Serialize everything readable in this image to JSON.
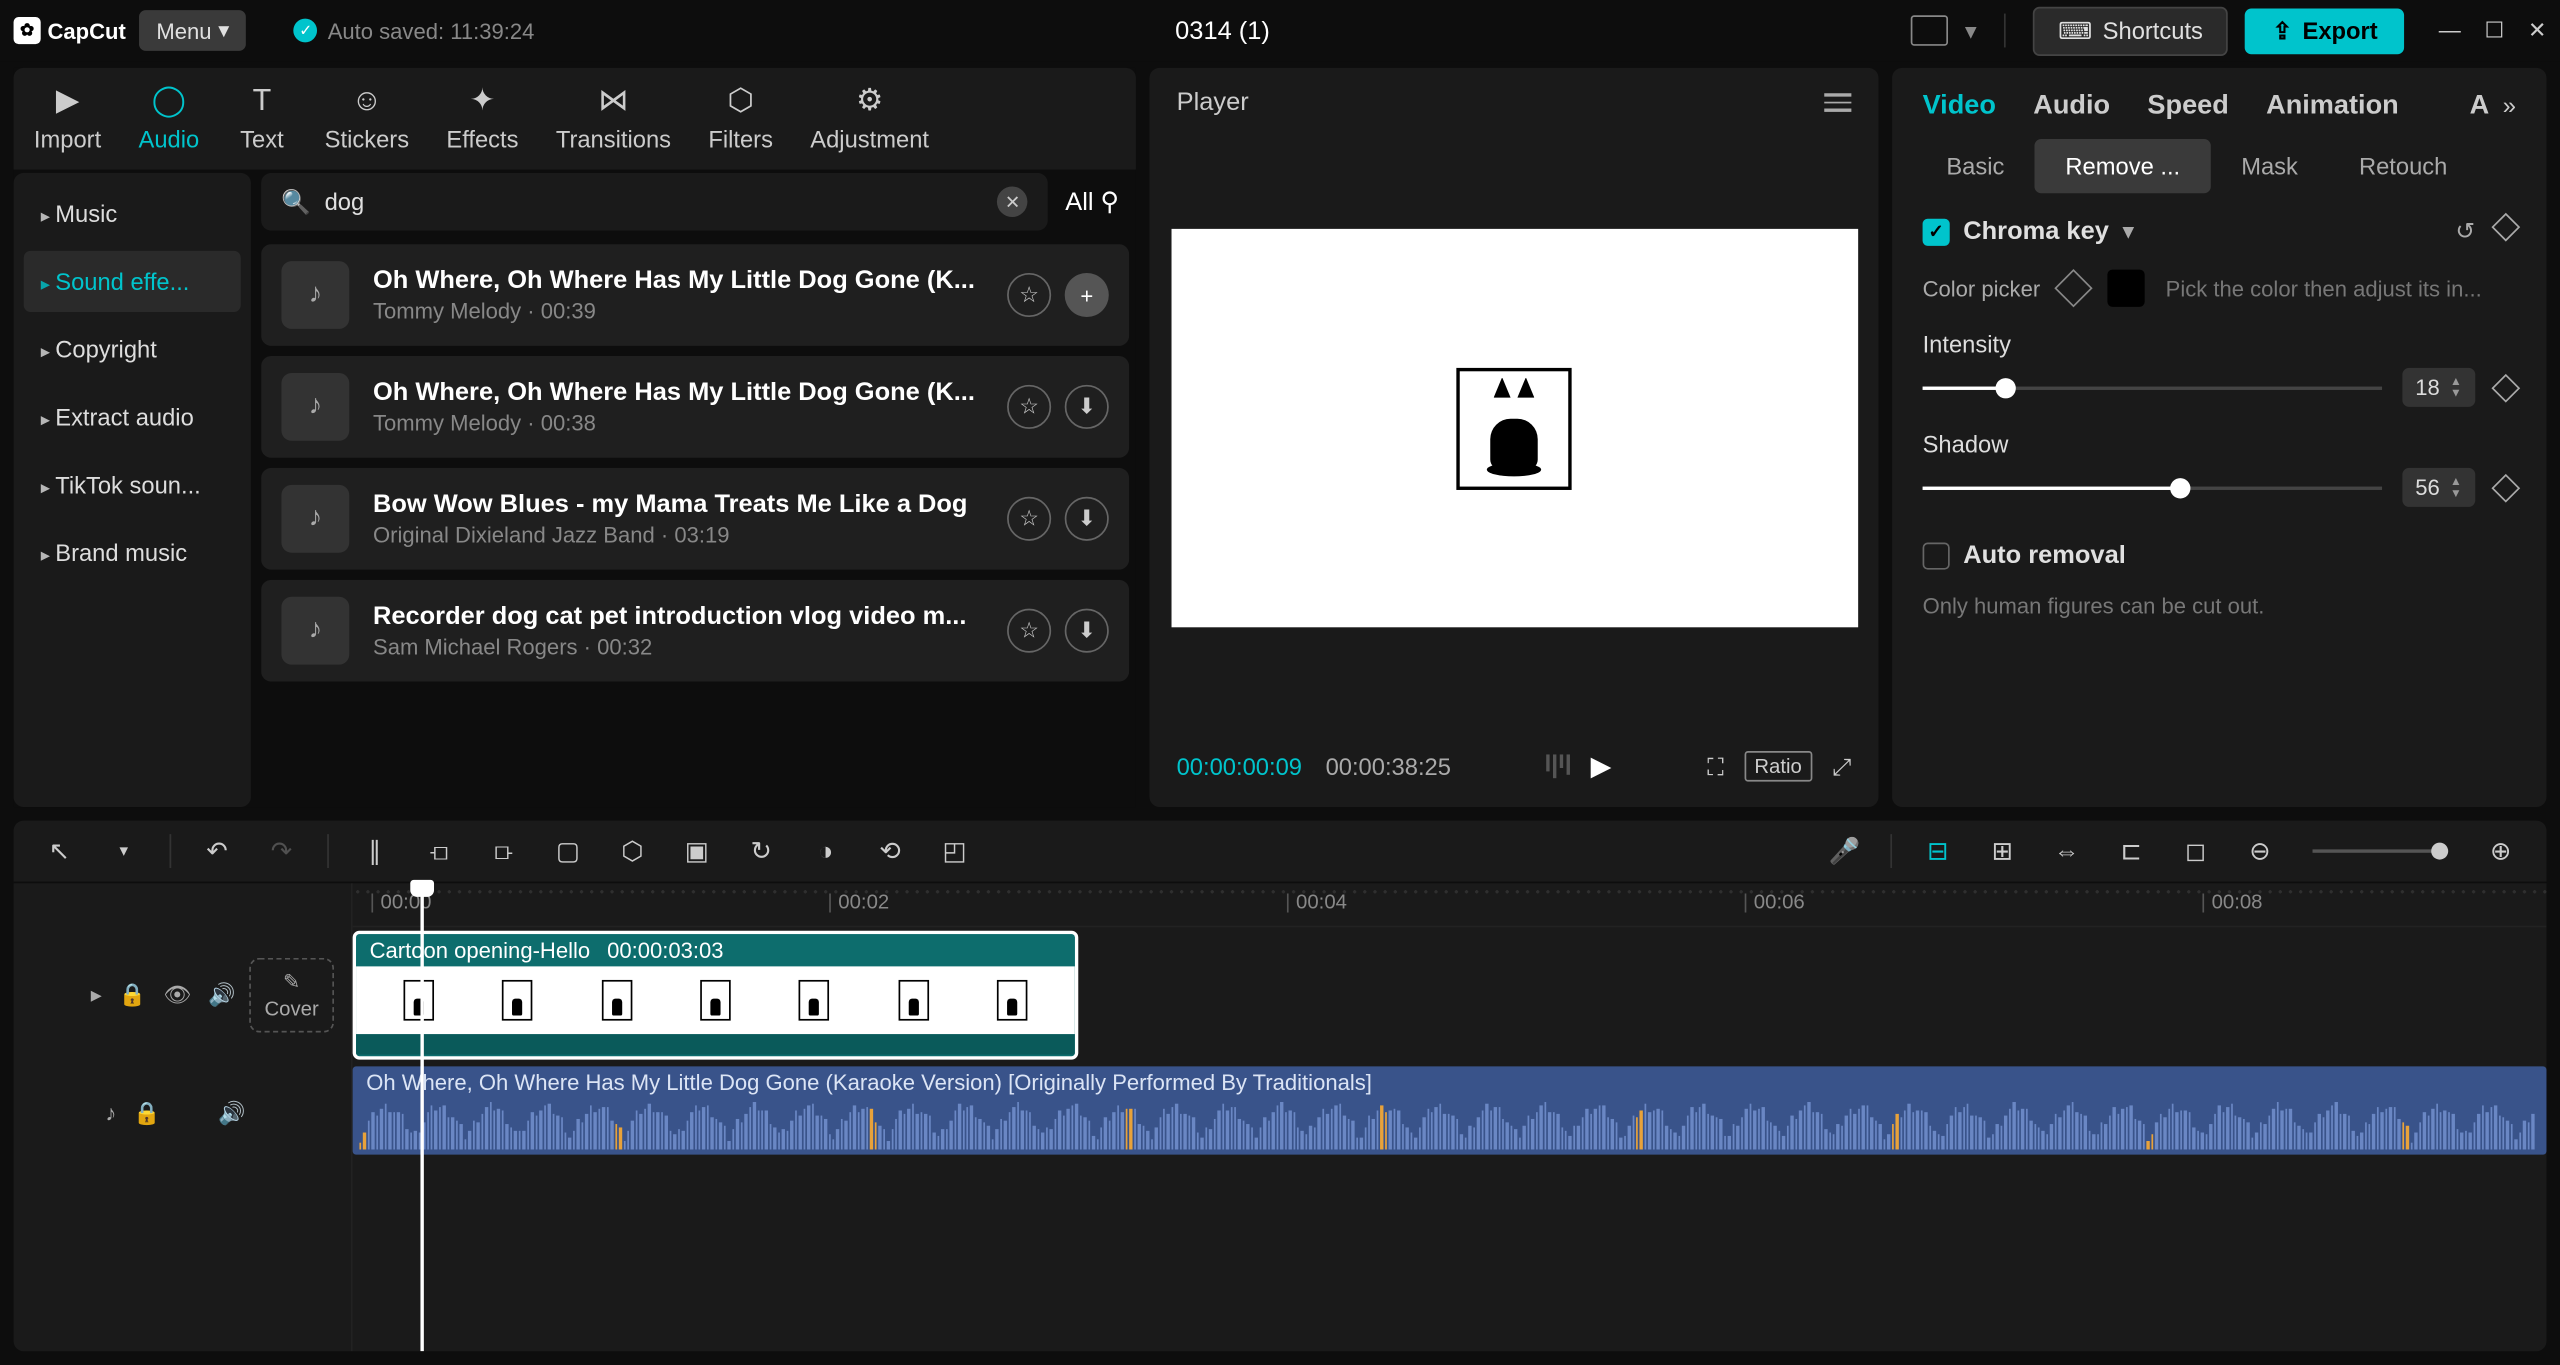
{
  "titlebar": {
    "app_name": "CapCut",
    "menu_label": "Menu",
    "autosave": "Auto saved: 11:39:24",
    "project_title": "0314 (1)",
    "shortcuts_label": "Shortcuts",
    "export_label": "Export"
  },
  "media_tabs": {
    "import": "Import",
    "audio": "Audio",
    "text": "Text",
    "stickers": "Stickers",
    "effects": "Effects",
    "transitions": "Transitions",
    "filters": "Filters",
    "adjustment": "Adjustment"
  },
  "side_cats": {
    "music": "Music",
    "sound_effects": "Sound effe...",
    "copyright": "Copyright",
    "extract": "Extract audio",
    "tiktok": "TikTok soun...",
    "brand": "Brand music"
  },
  "search": {
    "query": "dog",
    "filter_label": "All"
  },
  "results": [
    {
      "title": "Oh Where, Oh Where Has My Little Dog Gone (K...",
      "artist": "Tommy Melody",
      "dur": "00:39",
      "action": "add"
    },
    {
      "title": "Oh Where, Oh Where Has My Little Dog Gone (K...",
      "artist": "Tommy Melody",
      "dur": "00:38",
      "action": "download"
    },
    {
      "title": "Bow Wow Blues  - my Mama Treats Me Like a Dog",
      "artist": "Original Dixieland Jazz Band",
      "dur": "03:19",
      "action": "download"
    },
    {
      "title": "Recorder dog cat pet introduction vlog video m...",
      "artist": "Sam Michael Rogers",
      "dur": "00:32",
      "action": "download"
    }
  ],
  "player": {
    "label": "Player",
    "current_tc": "00:00:00:09",
    "duration_tc": "00:00:38:25",
    "ratio_label": "Ratio"
  },
  "inspector": {
    "tabs": {
      "video": "Video",
      "audio": "Audio",
      "speed": "Speed",
      "animation": "Animation",
      "more": "A"
    },
    "subtabs": {
      "basic": "Basic",
      "remove_bg": "Remove ...",
      "mask": "Mask",
      "retouch": "Retouch"
    },
    "chroma_label": "Chroma key",
    "picker_label": "Color picker",
    "picker_hint": "Pick the color then adjust its in...",
    "intensity_label": "Intensity",
    "intensity_value": "18",
    "shadow_label": "Shadow",
    "shadow_value": "56",
    "auto_removal_label": "Auto removal",
    "auto_removal_note": "Only human figures can be cut out."
  },
  "timeline": {
    "ticks": [
      "00:00",
      "00:02",
      "00:04",
      "00:06",
      "00:08"
    ],
    "cover_label": "Cover",
    "video_clip_name": "Cartoon opening-Hello",
    "video_clip_dur": "00:00:03:03",
    "audio_clip_name": "Oh Where, Oh Where Has My Little Dog Gone (Karaoke Version) [Originally Performed By Traditionals]"
  }
}
